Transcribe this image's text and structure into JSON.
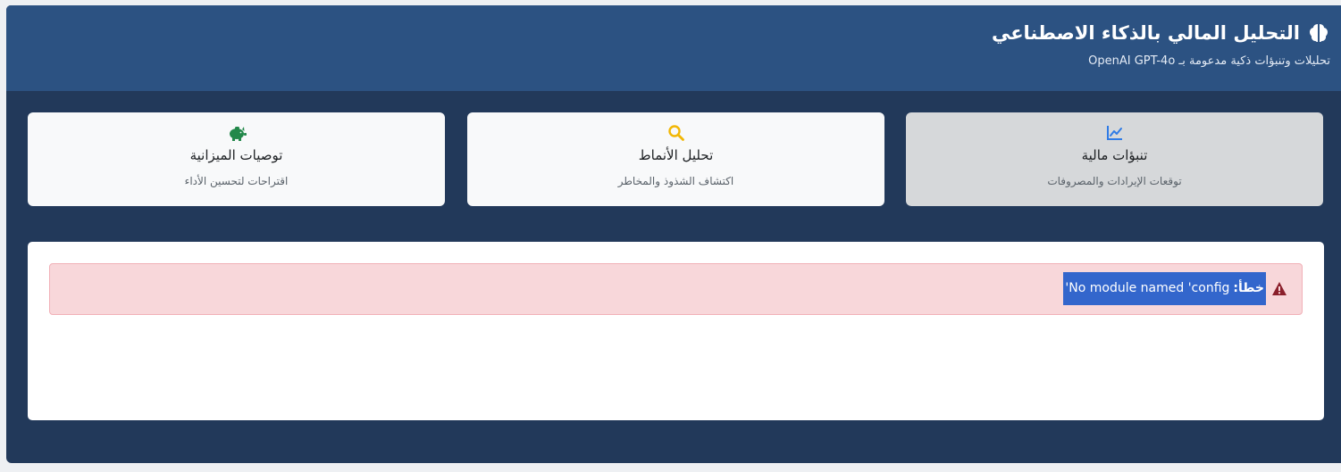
{
  "header": {
    "title": "التحليل المالي بالذكاء الاصطناعي",
    "subtitle": "تحليلات وتنبؤات ذكية مدعومة بـ OpenAI GPT-4o",
    "title_icon": "brain-icon"
  },
  "cards": [
    {
      "title": "تنبؤات مالية",
      "description": "توقعات الإيرادات والمصروفات",
      "icon": "chart-line-icon",
      "icon_color": "#2f7be6",
      "active": true
    },
    {
      "title": "تحليل الأنماط",
      "description": "اكتشاف الشذوذ والمخاطر",
      "icon": "search-icon",
      "icon_color": "#f2b705",
      "active": false
    },
    {
      "title": "توصيات الميزانية",
      "description": "اقتراحات لتحسين الأداء",
      "icon": "piggy-bank-icon",
      "icon_color": "#23884a",
      "active": false
    }
  ],
  "alert": {
    "label": "خطأ:",
    "message": "No module named 'config'",
    "icon": "warning-triangle-icon",
    "icon_color": "#8b1f2b"
  },
  "colors": {
    "frame_bg": "#22395a",
    "header_bg": "#2c5282",
    "alert_bg": "#f8d7da",
    "selection_bg": "#3366cc"
  }
}
